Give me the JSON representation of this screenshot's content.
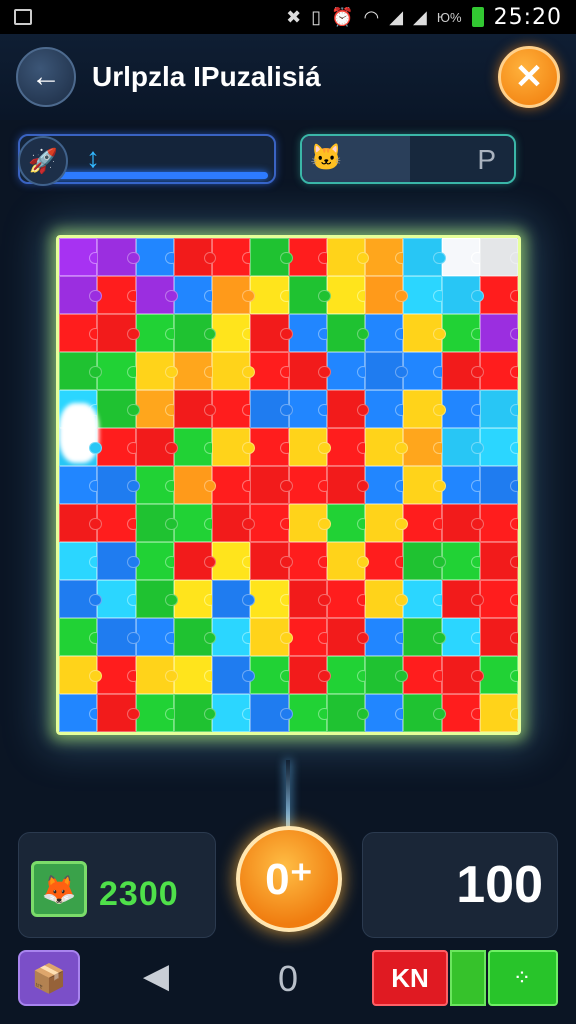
{
  "status_bar": {
    "time": "25:20",
    "battery_text": "Ю%",
    "icons": [
      "screenshot-icon",
      "nfc-icon",
      "sim-icon",
      "alarm-icon",
      "wifi-icon",
      "signal-icon",
      "signal-icon",
      "battery-icon"
    ]
  },
  "header": {
    "title": "Urlpzla IPuzalisiá",
    "back_icon": "←",
    "close_icon": "✕"
  },
  "progress": {
    "rocket_icon": "🚀",
    "marker": "↕"
  },
  "hint": {
    "icon": "🐱",
    "letter": "P"
  },
  "board": {
    "cols": 12,
    "rows": 13,
    "colors": {
      "R": "#f21b1b",
      "G": "#1fc231",
      "B": "#1f7cf0",
      "Y": "#ffd31a",
      "O": "#ff9a1a",
      "P": "#9b2ee0",
      "C": "#28c6f5",
      "W": "#e4e6e8"
    },
    "layout": [
      "PPBRRGRYOCWW",
      "PRPBOYGYOCCR",
      "RRGGYRBGBYGP",
      "GGYOYRRBBBRR",
      "CGORRBBRBYBC",
      "CRRGYRYRYOCC",
      "BBGORRRRBYBB",
      "RRGGRRYGYRRR",
      "CBGRYRRYRGGR",
      "BCGYBYRRYCRR",
      "GBBGCYRRBGCR",
      "YRYYBGRGGRRG",
      "BRGGCBGGBGRY"
    ]
  },
  "bottom": {
    "score": "2300",
    "score_icon": "🦊",
    "coin_label": "0⁺",
    "right_value": "100",
    "box_icon": "📦",
    "prev_icon": "◀",
    "page": "0",
    "red_button": "KN",
    "green_button": "⁘"
  }
}
